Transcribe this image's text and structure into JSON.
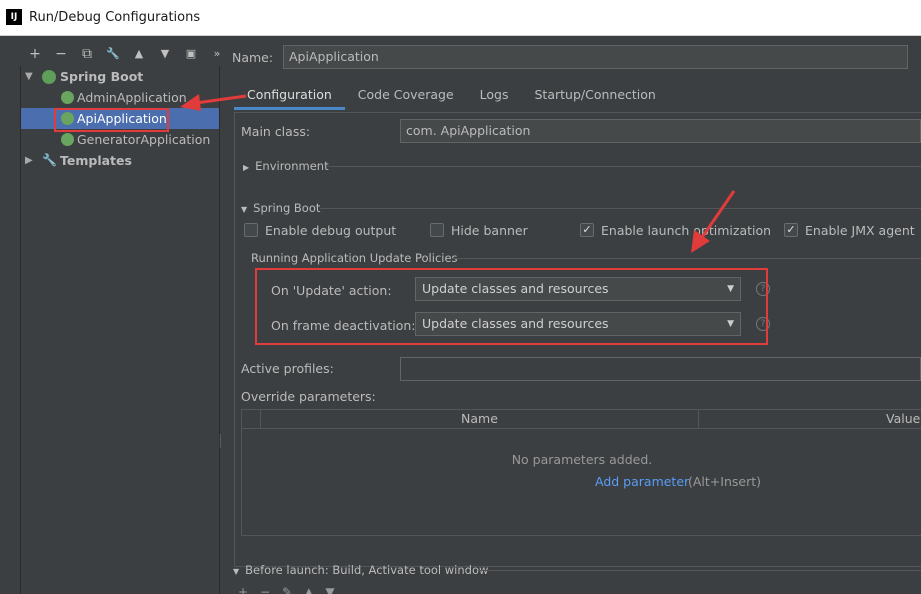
{
  "window": {
    "title": "Run/Debug Configurations",
    "app_icon": "IJ"
  },
  "toolbar": {
    "icons": [
      "+",
      "−",
      "⧉",
      "🔧",
      "▲",
      "▼",
      "▣",
      "»"
    ]
  },
  "tree": {
    "spring_boot": "Spring Boot",
    "items": [
      {
        "label": "AdminApplication",
        "selected": false
      },
      {
        "label": "ApiApplication",
        "selected": true
      },
      {
        "label": "GeneratorApplication",
        "selected": false
      }
    ],
    "templates": "Templates"
  },
  "name": {
    "label": "Name:",
    "value": "ApiApplication"
  },
  "tabs": [
    {
      "label": "Configuration",
      "active": true
    },
    {
      "label": "Code Coverage",
      "active": false
    },
    {
      "label": "Logs",
      "active": false
    },
    {
      "label": "Startup/Connection",
      "active": false
    }
  ],
  "main_class": {
    "label": "Main class:",
    "value": "com.      ApiApplication"
  },
  "environment": {
    "label": "Environment"
  },
  "spring_boot_section": {
    "label": "Spring Boot",
    "checkboxes": [
      {
        "label": "Enable debug output",
        "checked": false
      },
      {
        "label": "Hide banner",
        "checked": false
      },
      {
        "label": "Enable launch optimization",
        "checked": true
      },
      {
        "label": "Enable JMX agent",
        "checked": true
      }
    ]
  },
  "policies": {
    "label": "Running Application Update Policies",
    "on_update_label": "On 'Update' action:",
    "on_update_value": "Update classes and resources",
    "on_frame_label": "On frame deactivation:",
    "on_frame_value": "Update classes and resources"
  },
  "active_profiles": {
    "label": "Active profiles:",
    "value": ""
  },
  "override": {
    "label": "Override parameters:",
    "columns": [
      "Name",
      "Value"
    ],
    "empty_text": "No parameters added.",
    "add_link": "Add parameter",
    "add_hint": "(Alt+Insert)"
  },
  "before_launch": {
    "label": "Before launch: Build, Activate tool window"
  },
  "colors": {
    "background": "#3c3f41",
    "selection": "#4b6eaf",
    "accent": "#4a88c7",
    "link": "#589df6",
    "annotation": "#e23b3b"
  }
}
